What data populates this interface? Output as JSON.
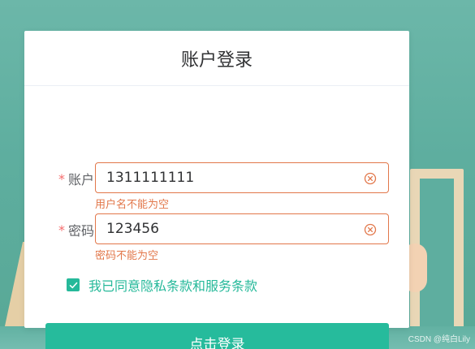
{
  "card": {
    "title": "账户登录"
  },
  "form": {
    "account": {
      "label": "账户",
      "value": "1311111111",
      "error": "用户名不能为空"
    },
    "password": {
      "label": "密码",
      "value": "123456",
      "error": "密码不能为空"
    },
    "required_mark": "*",
    "agree": {
      "checked": true,
      "label": "我已同意隐私条款和服务条款"
    },
    "submit_label": "点击登录"
  },
  "watermark": "CSDN @纯白Lily",
  "colors": {
    "accent": "#26bb9c",
    "error": "#e2774a",
    "background": "#5eae9f"
  }
}
